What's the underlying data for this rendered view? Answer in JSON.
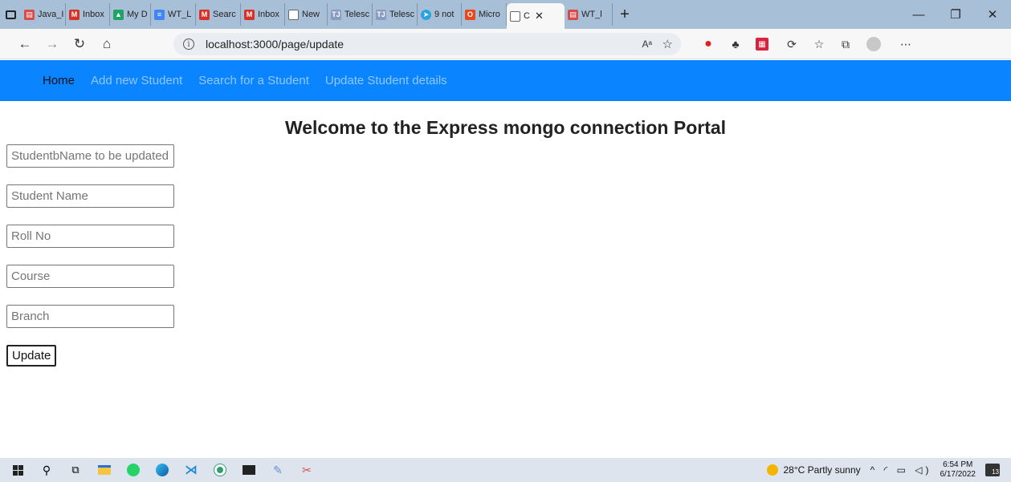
{
  "browser": {
    "tabs": [
      {
        "label": "Java_I",
        "icon": "pdf-icon",
        "color": "#d84b4b"
      },
      {
        "label": "Inbox",
        "icon": "gmail-icon",
        "color": "#d93025"
      },
      {
        "label": "My D",
        "icon": "drive-icon",
        "color": "#1fa463"
      },
      {
        "label": "WT_L",
        "icon": "docs-icon",
        "color": "#4285f4"
      },
      {
        "label": "Searc",
        "icon": "gmail-icon",
        "color": "#d93025"
      },
      {
        "label": "Inbox",
        "icon": "gmail-icon",
        "color": "#d93025"
      },
      {
        "label": "New",
        "icon": "page-icon",
        "color": "#666666"
      },
      {
        "label": "Telesc",
        "icon": "telescope-icon",
        "color": "#8a9cc2"
      },
      {
        "label": "Telesc",
        "icon": "telescope-icon",
        "color": "#8a9cc2"
      },
      {
        "label": "9 not",
        "icon": "telegram-icon",
        "color": "#2aa3df"
      },
      {
        "label": "Micro",
        "icon": "office-icon",
        "color": "#e8481b"
      },
      {
        "label": "C",
        "icon": "page-icon",
        "color": "#666666",
        "active": true
      },
      {
        "label": "WT_l",
        "icon": "pdf-icon",
        "color": "#d84b4b"
      }
    ],
    "url": "localhost:3000/page/update",
    "read_aloud": "Aᵃ",
    "window_controls": {
      "minimize": "—",
      "restore": "❐",
      "close": "✕"
    }
  },
  "navbar": {
    "items": [
      {
        "label": "Home",
        "active": true
      },
      {
        "label": "Add new Student"
      },
      {
        "label": "Search for a Student"
      },
      {
        "label": "Update Student details"
      }
    ]
  },
  "page": {
    "title": "Welcome to the Express mongo connection Portal",
    "fields": [
      {
        "placeholder": "StudentbName to be updated"
      },
      {
        "placeholder": "Student Name"
      },
      {
        "placeholder": "Roll No"
      },
      {
        "placeholder": "Course"
      },
      {
        "placeholder": "Branch"
      }
    ],
    "submit_label": "Update"
  },
  "taskbar": {
    "weather": "28°C  Partly sunny",
    "time": "6:54 PM",
    "date": "6/17/2022",
    "notifications": "13"
  }
}
